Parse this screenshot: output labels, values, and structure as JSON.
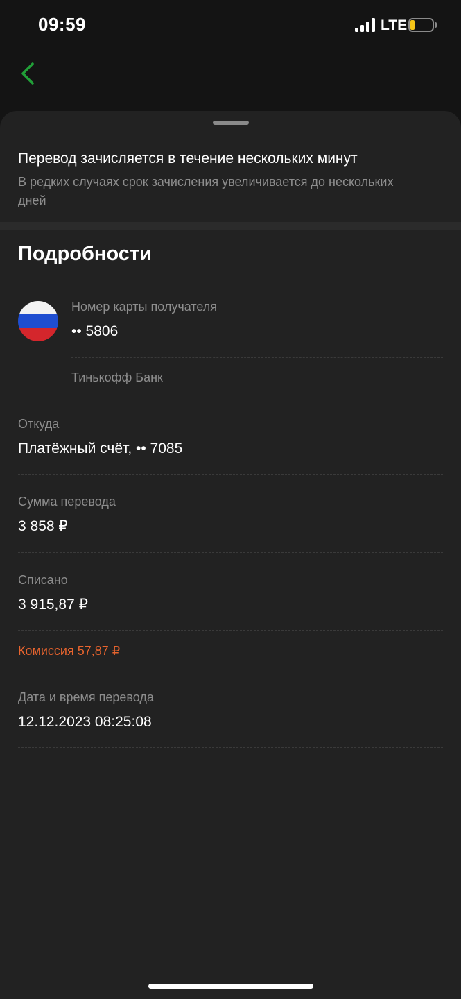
{
  "status_bar": {
    "time": "09:59",
    "network": "LTE",
    "battery_level_fraction": 0.2,
    "battery_color": "#f5c518"
  },
  "nav": {
    "back_icon": "chevron-left-icon",
    "accent_color": "#21a038"
  },
  "notice": {
    "title": "Перевод зачисляется в течение нескольких минут",
    "subtitle": "В редких случаях срок зачисления увеличивается до нескольких дней"
  },
  "details": {
    "heading": "Подробности",
    "recipient": {
      "flag_icon": "russia-flag-icon",
      "label": "Номер карты получателя",
      "value": "•• 5806",
      "bank": "Тинькофф Банк"
    },
    "from": {
      "label": "Откуда",
      "value": "Платёжный счёт, •• 7085"
    },
    "amount": {
      "label": "Сумма перевода",
      "value": "3 858 ₽"
    },
    "debited": {
      "label": "Списано",
      "value": "3 915,87 ₽"
    },
    "commission": {
      "label": "Комиссия 57,87 ₽",
      "color": "#e8642e"
    },
    "datetime": {
      "label": "Дата и время перевода",
      "value": "12.12.2023 08:25:08"
    }
  }
}
